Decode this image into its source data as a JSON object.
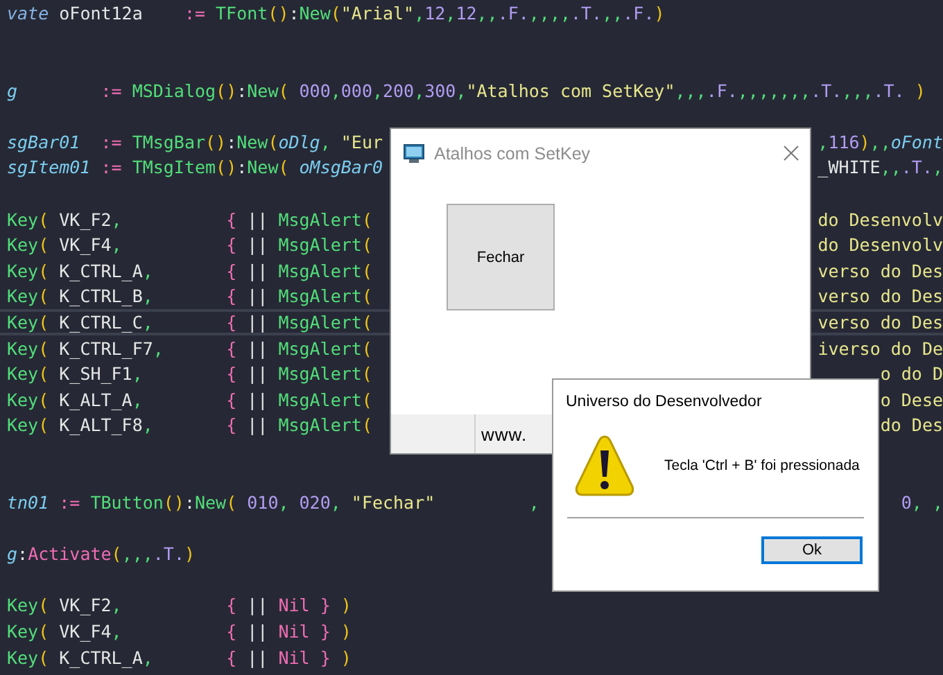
{
  "editor": {
    "lines": [
      {
        "current": false,
        "left": [
          {
            "text": "vate ",
            "kind": "kw"
          },
          {
            "text": "oFont12a    ",
            "kind": "id"
          },
          {
            "text": ":= ",
            "kind": "op"
          },
          {
            "text": "TFont",
            "kind": "fn"
          },
          {
            "text": "()",
            "kind": "br"
          },
          {
            "text": ":",
            "kind": "id"
          },
          {
            "text": "New",
            "kind": "fn"
          },
          {
            "text": "(",
            "kind": "br"
          },
          {
            "text": "\"Arial\"",
            "kind": "str"
          },
          {
            "text": ",",
            "kind": "pu"
          },
          {
            "text": "12",
            "kind": "num"
          },
          {
            "text": ",",
            "kind": "pu"
          },
          {
            "text": "12",
            "kind": "num"
          },
          {
            "text": ",,",
            "kind": "pu"
          },
          {
            "text": ".F.",
            "kind": "num"
          },
          {
            "text": ",,,,",
            "kind": "pu"
          },
          {
            "text": ".T.",
            "kind": "num"
          },
          {
            "text": ",,",
            "kind": "pu"
          },
          {
            "text": ".F.",
            "kind": "num"
          },
          {
            "text": ")",
            "kind": "br"
          }
        ]
      },
      {
        "current": false
      },
      {
        "current": false
      },
      {
        "current": false,
        "left": [
          {
            "text": "g",
            "kind": "var"
          },
          {
            "text": "        := ",
            "kind": "op"
          },
          {
            "text": "MSDialog",
            "kind": "fn"
          },
          {
            "text": "()",
            "kind": "br"
          },
          {
            "text": ":",
            "kind": "id"
          },
          {
            "text": "New",
            "kind": "fn"
          },
          {
            "text": "( ",
            "kind": "br"
          },
          {
            "text": "000",
            "kind": "num"
          },
          {
            "text": ",",
            "kind": "pu"
          },
          {
            "text": "000",
            "kind": "num"
          },
          {
            "text": ",",
            "kind": "pu"
          },
          {
            "text": "200",
            "kind": "num"
          },
          {
            "text": ",",
            "kind": "pu"
          },
          {
            "text": "300",
            "kind": "num"
          },
          {
            "text": ",",
            "kind": "pu"
          },
          {
            "text": "\"Atalhos com SetKey\"",
            "kind": "str"
          },
          {
            "text": ",,,",
            "kind": "pu"
          },
          {
            "text": ".F.",
            "kind": "num"
          },
          {
            "text": ",,,,,,,",
            "kind": "pu"
          },
          {
            "text": ".T.",
            "kind": "num"
          },
          {
            "text": ",,,",
            "kind": "pu"
          },
          {
            "text": ".T.",
            "kind": "num"
          },
          {
            "text": " )",
            "kind": "br"
          }
        ]
      },
      {
        "current": false
      },
      {
        "current": false,
        "left": [
          {
            "text": "sgBar01",
            "kind": "var"
          },
          {
            "text": "  := ",
            "kind": "op"
          },
          {
            "text": "TMsgBar",
            "kind": "fn"
          },
          {
            "text": "()",
            "kind": "br"
          },
          {
            "text": ":",
            "kind": "id"
          },
          {
            "text": "New",
            "kind": "fn"
          },
          {
            "text": "(",
            "kind": "br"
          },
          {
            "text": "oDlg",
            "kind": "var"
          },
          {
            "text": ", ",
            "kind": "pu"
          },
          {
            "text": "\"Eur",
            "kind": "str"
          }
        ],
        "right": [
          {
            "text": ",",
            "kind": "pu"
          },
          {
            "text": "116",
            "kind": "num"
          },
          {
            "text": ")",
            "kind": "br"
          },
          {
            "text": ",,",
            "kind": "pu"
          },
          {
            "text": "oFont",
            "kind": "var"
          }
        ]
      },
      {
        "current": false,
        "left": [
          {
            "text": "sgItem01",
            "kind": "var"
          },
          {
            "text": " := ",
            "kind": "op"
          },
          {
            "text": "TMsgItem",
            "kind": "fn"
          },
          {
            "text": "()",
            "kind": "br"
          },
          {
            "text": ":",
            "kind": "id"
          },
          {
            "text": "New",
            "kind": "fn"
          },
          {
            "text": "( ",
            "kind": "br"
          },
          {
            "text": "oMsgBar0",
            "kind": "var"
          }
        ],
        "right": [
          {
            "text": "_WHITE",
            "kind": "id"
          },
          {
            "text": ",,",
            "kind": "pu"
          },
          {
            "text": ".T.",
            "kind": "num"
          },
          {
            "text": ",",
            "kind": "pu"
          }
        ]
      },
      {
        "current": false
      },
      {
        "current": false,
        "left": [
          {
            "text": "Key",
            "kind": "fn"
          },
          {
            "text": "( ",
            "kind": "br"
          },
          {
            "text": "VK_F2",
            "kind": "id"
          },
          {
            "text": ",          ",
            "kind": "pu"
          },
          {
            "text": "{ ",
            "kind": "op"
          },
          {
            "text": "|| ",
            "kind": "id"
          },
          {
            "text": "MsgAlert",
            "kind": "fn"
          },
          {
            "text": "(",
            "kind": "br"
          }
        ],
        "right": [
          {
            "text": "do Desenvolv",
            "kind": "str"
          }
        ]
      },
      {
        "current": false,
        "left": [
          {
            "text": "Key",
            "kind": "fn"
          },
          {
            "text": "( ",
            "kind": "br"
          },
          {
            "text": "VK_F4",
            "kind": "id"
          },
          {
            "text": ",          ",
            "kind": "pu"
          },
          {
            "text": "{ ",
            "kind": "op"
          },
          {
            "text": "|| ",
            "kind": "id"
          },
          {
            "text": "MsgAlert",
            "kind": "fn"
          },
          {
            "text": "(",
            "kind": "br"
          }
        ],
        "right": [
          {
            "text": "do Desenvolv",
            "kind": "str"
          }
        ]
      },
      {
        "current": false,
        "left": [
          {
            "text": "Key",
            "kind": "fn"
          },
          {
            "text": "( ",
            "kind": "br"
          },
          {
            "text": "K_CTRL_A",
            "kind": "id"
          },
          {
            "text": ",       ",
            "kind": "pu"
          },
          {
            "text": "{ ",
            "kind": "op"
          },
          {
            "text": "|| ",
            "kind": "id"
          },
          {
            "text": "MsgAlert",
            "kind": "fn"
          },
          {
            "text": "(",
            "kind": "br"
          }
        ],
        "right": [
          {
            "text": "verso do Des",
            "kind": "str"
          }
        ]
      },
      {
        "current": false,
        "left": [
          {
            "text": "Key",
            "kind": "fn"
          },
          {
            "text": "( ",
            "kind": "br"
          },
          {
            "text": "K_CTRL_B",
            "kind": "id"
          },
          {
            "text": ",       ",
            "kind": "pu"
          },
          {
            "text": "{ ",
            "kind": "op"
          },
          {
            "text": "|| ",
            "kind": "id"
          },
          {
            "text": "MsgAlert",
            "kind": "fn"
          },
          {
            "text": "(",
            "kind": "br"
          }
        ],
        "right": [
          {
            "text": "verso do Des",
            "kind": "str"
          }
        ]
      },
      {
        "current": true,
        "left": [
          {
            "text": "Key",
            "kind": "fn"
          },
          {
            "text": "( ",
            "kind": "br"
          },
          {
            "text": "K_CTRL_C",
            "kind": "id"
          },
          {
            "text": ",       ",
            "kind": "pu"
          },
          {
            "text": "{ ",
            "kind": "op"
          },
          {
            "text": "|| ",
            "kind": "id"
          },
          {
            "text": "MsgAlert",
            "kind": "fn"
          },
          {
            "text": "(",
            "kind": "br"
          }
        ],
        "right": [
          {
            "text": "verso do Des",
            "kind": "str"
          }
        ]
      },
      {
        "current": false,
        "left": [
          {
            "text": "Key",
            "kind": "fn"
          },
          {
            "text": "( ",
            "kind": "br"
          },
          {
            "text": "K_CTRL_F7",
            "kind": "id"
          },
          {
            "text": ",      ",
            "kind": "pu"
          },
          {
            "text": "{ ",
            "kind": "op"
          },
          {
            "text": "|| ",
            "kind": "id"
          },
          {
            "text": "MsgAlert",
            "kind": "fn"
          },
          {
            "text": "(",
            "kind": "br"
          }
        ],
        "right": [
          {
            "text": "iverso do De",
            "kind": "str"
          }
        ]
      },
      {
        "current": false,
        "left": [
          {
            "text": "Key",
            "kind": "fn"
          },
          {
            "text": "( ",
            "kind": "br"
          },
          {
            "text": "K_SH_F1",
            "kind": "id"
          },
          {
            "text": ",        ",
            "kind": "pu"
          },
          {
            "text": "{ ",
            "kind": "op"
          },
          {
            "text": "|| ",
            "kind": "id"
          },
          {
            "text": "MsgAlert",
            "kind": "fn"
          },
          {
            "text": "(",
            "kind": "br"
          }
        ],
        "right": [
          {
            "text": "o do D",
            "kind": "str"
          }
        ]
      },
      {
        "current": false,
        "left": [
          {
            "text": "Key",
            "kind": "fn"
          },
          {
            "text": "( ",
            "kind": "br"
          },
          {
            "text": "K_ALT_A",
            "kind": "id"
          },
          {
            "text": ",        ",
            "kind": "pu"
          },
          {
            "text": "{ ",
            "kind": "op"
          },
          {
            "text": "|| ",
            "kind": "id"
          },
          {
            "text": "MsgAlert",
            "kind": "fn"
          },
          {
            "text": "(",
            "kind": "br"
          }
        ],
        "right": [
          {
            "text": "o Dese",
            "kind": "str"
          }
        ]
      },
      {
        "current": false,
        "left": [
          {
            "text": "Key",
            "kind": "fn"
          },
          {
            "text": "( ",
            "kind": "br"
          },
          {
            "text": "K_ALT_F8",
            "kind": "id"
          },
          {
            "text": ",       ",
            "kind": "pu"
          },
          {
            "text": "{ ",
            "kind": "op"
          },
          {
            "text": "|| ",
            "kind": "id"
          },
          {
            "text": "MsgAlert",
            "kind": "fn"
          },
          {
            "text": "(",
            "kind": "br"
          }
        ],
        "right": [
          {
            "text": "do Des",
            "kind": "str"
          }
        ]
      },
      {
        "current": false
      },
      {
        "current": false
      },
      {
        "current": false,
        "left": [
          {
            "text": "tn01",
            "kind": "var"
          },
          {
            "text": " := ",
            "kind": "op"
          },
          {
            "text": "TButton",
            "kind": "fn"
          },
          {
            "text": "()",
            "kind": "br"
          },
          {
            "text": ":",
            "kind": "id"
          },
          {
            "text": "New",
            "kind": "fn"
          },
          {
            "text": "( ",
            "kind": "br"
          },
          {
            "text": "010",
            "kind": "num"
          },
          {
            "text": ", ",
            "kind": "pu"
          },
          {
            "text": "020",
            "kind": "num"
          },
          {
            "text": ", ",
            "kind": "pu"
          },
          {
            "text": "\"Fechar\"",
            "kind": "str"
          },
          {
            "text": "         ,",
            "kind": "pu"
          }
        ],
        "right": [
          {
            "text": "0",
            "kind": "num"
          },
          {
            "text": ", ,",
            "kind": "pu"
          }
        ]
      },
      {
        "current": false
      },
      {
        "current": false,
        "left": [
          {
            "text": "g",
            "kind": "var"
          },
          {
            "text": ":",
            "kind": "id"
          },
          {
            "text": "Activate",
            "kind": "op"
          },
          {
            "text": "(",
            "kind": "br"
          },
          {
            "text": ",,,",
            "kind": "pu"
          },
          {
            "text": ".T.",
            "kind": "num"
          },
          {
            "text": ")",
            "kind": "br"
          }
        ]
      },
      {
        "current": false
      },
      {
        "current": false,
        "left": [
          {
            "text": "Key",
            "kind": "fn"
          },
          {
            "text": "( ",
            "kind": "br"
          },
          {
            "text": "VK_F2",
            "kind": "id"
          },
          {
            "text": ",          ",
            "kind": "pu"
          },
          {
            "text": "{ ",
            "kind": "op"
          },
          {
            "text": "|| ",
            "kind": "id"
          },
          {
            "text": "Nil } ",
            "kind": "op"
          },
          {
            "text": ")",
            "kind": "br"
          }
        ]
      },
      {
        "current": false,
        "left": [
          {
            "text": "Key",
            "kind": "fn"
          },
          {
            "text": "( ",
            "kind": "br"
          },
          {
            "text": "VK_F4",
            "kind": "id"
          },
          {
            "text": ",          ",
            "kind": "pu"
          },
          {
            "text": "{ ",
            "kind": "op"
          },
          {
            "text": "|| ",
            "kind": "id"
          },
          {
            "text": "Nil } ",
            "kind": "op"
          },
          {
            "text": ")",
            "kind": "br"
          }
        ]
      },
      {
        "current": false,
        "left": [
          {
            "text": "Key",
            "kind": "fn"
          },
          {
            "text": "( ",
            "kind": "br"
          },
          {
            "text": "K_CTRL_A",
            "kind": "id"
          },
          {
            "text": ",       ",
            "kind": "pu"
          },
          {
            "text": "{ ",
            "kind": "op"
          },
          {
            "text": "|| ",
            "kind": "id"
          },
          {
            "text": "Nil } ",
            "kind": "op"
          },
          {
            "text": ")",
            "kind": "br"
          }
        ]
      }
    ]
  },
  "dialog": {
    "title": "Atalhos com SetKey",
    "button": "Fechar",
    "status_text": "www."
  },
  "alert": {
    "title": "Universo do Desenvolvedor",
    "message": "Tecla 'Ctrl + B' foi pressionada",
    "button": "Ok"
  }
}
